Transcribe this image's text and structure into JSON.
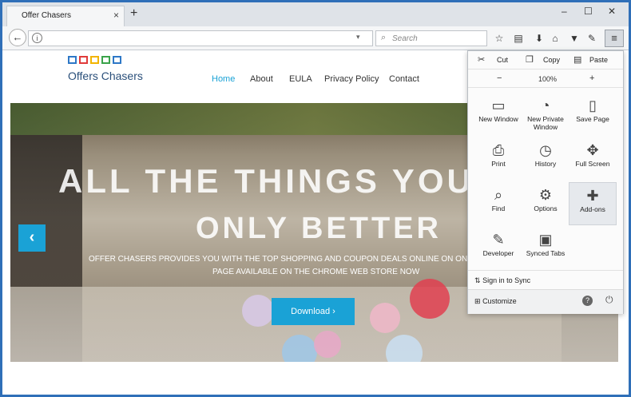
{
  "browser": {
    "tab_title": "Offer Chasers",
    "tab_close": "×",
    "new_tab": "+",
    "window_controls": [
      "–",
      "☐",
      "✕"
    ],
    "back": "←",
    "reload": "↻",
    "url_dropdown": "▾",
    "search_placeholder": "Search",
    "toolbar_icons": [
      "☆",
      "▤",
      "⌂",
      "▼",
      "✎"
    ],
    "menu_button": "≡"
  },
  "site": {
    "logo_text": "Offers Chasers",
    "logo_colors": [
      "#2e78c7",
      "#e03b3b",
      "#f2b400",
      "#3aa34a",
      "#2e78c7"
    ],
    "nav": [
      "Home",
      "About",
      "EULA",
      "Privacy Policy",
      "Contact"
    ],
    "accent": "#1aa2d6",
    "hero": {
      "line1": "ALL THE THINGS YOU L",
      "line2": "ONLY BETTER",
      "desc1": "OFFER CHASERS PROVIDES YOU WITH THE TOP SHOPPING AND COUPON DEALS ONLINE ON ONE",
      "desc2": "PAGE AVAILABLE ON THE CHROME WEB STORE NOW",
      "prev": "‹",
      "download": "Download ›"
    }
  },
  "menu": {
    "cut": "Cut",
    "copy": "Copy",
    "paste": "Paste",
    "zoom_out": "−",
    "zoom_level": "100%",
    "zoom_in": "+",
    "items": [
      {
        "icon": "▭",
        "label": "New Window"
      },
      {
        "icon": "◔",
        "label": "New Private Window"
      },
      {
        "icon": "▯",
        "label": "Save Page"
      },
      {
        "icon": "⎙",
        "label": "Print"
      },
      {
        "icon": "◷",
        "label": "History"
      },
      {
        "icon": "✥",
        "label": "Full Screen"
      },
      {
        "icon": "⌕",
        "label": "Find"
      },
      {
        "icon": "⚙",
        "label": "Options"
      },
      {
        "icon": "✚",
        "label": "Add-ons"
      },
      {
        "icon": "✎",
        "label": "Developer"
      },
      {
        "icon": "▣",
        "label": "Synced Tabs"
      }
    ],
    "sign_in": "Sign in to Sync",
    "customize": "Customize"
  }
}
